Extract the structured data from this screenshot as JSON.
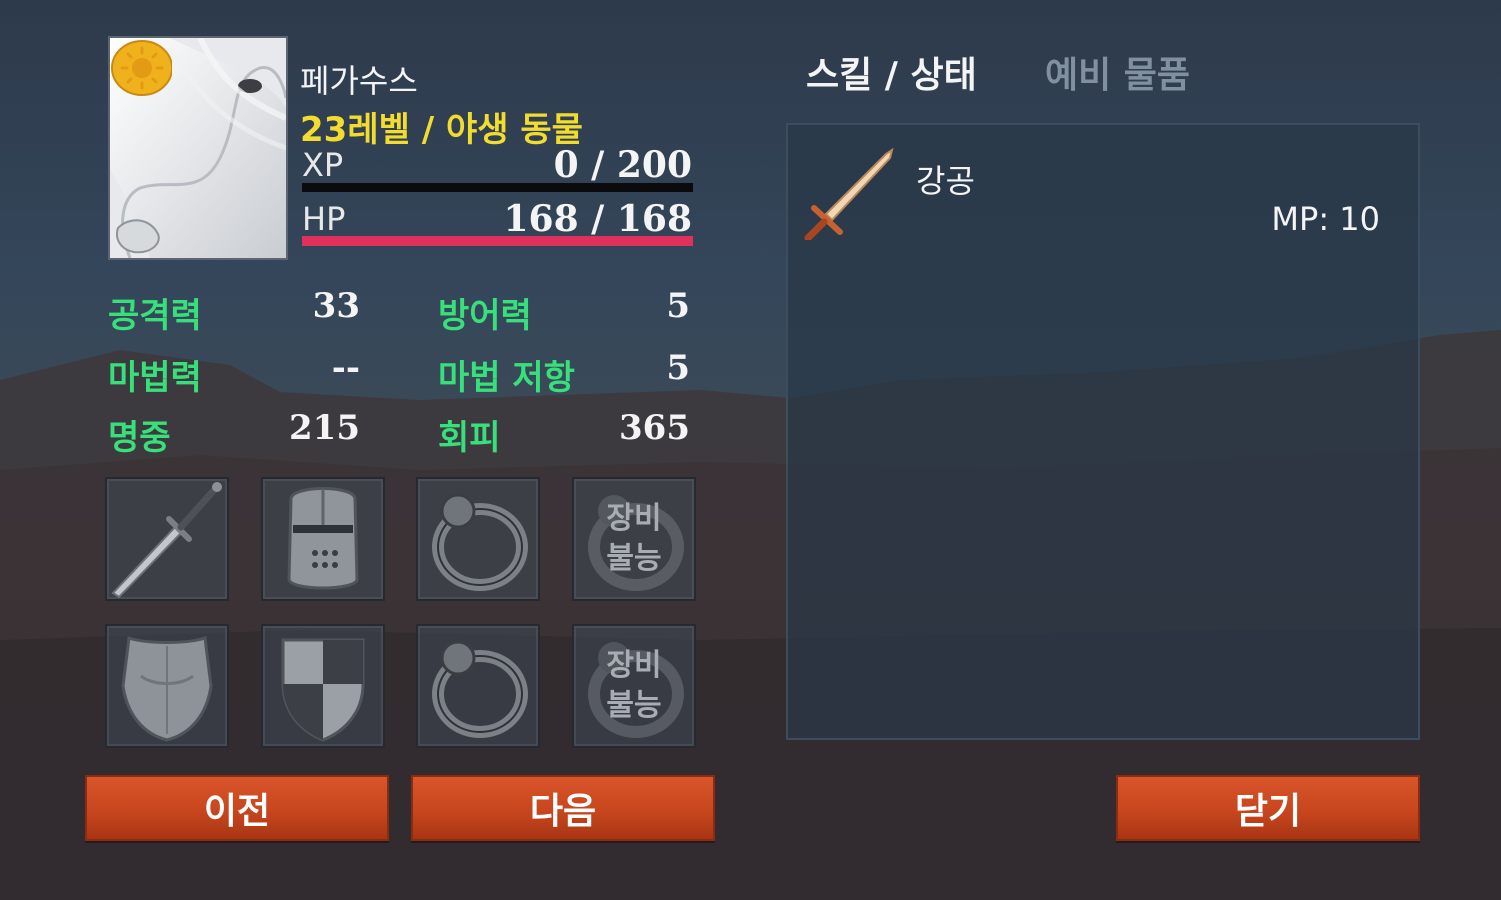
{
  "character": {
    "name": "페가수스",
    "level_line": "23레벨 / 야생 동물",
    "xp_label": "XP",
    "xp_value": "0 / 200",
    "xp_fraction": 0,
    "hp_label": "HP",
    "hp_value": "168 / 168",
    "hp_fraction": 1,
    "portrait_icon": "white-horse-portrait",
    "badge_icon": "sun-icon",
    "colors": {
      "level": "#f2dc2e",
      "stat_label": "#37e07a",
      "hp_bar": "#e0305e",
      "xp_bar": "#0b0b0d"
    }
  },
  "stats": [
    {
      "label": "공격력",
      "value": "33"
    },
    {
      "label": "방어력",
      "value": "5"
    },
    {
      "label": "마법력",
      "value": "--"
    },
    {
      "label": "마법 저항",
      "value": "5"
    },
    {
      "label": "명중",
      "value": "215"
    },
    {
      "label": "회피",
      "value": "365"
    }
  ],
  "equipment": {
    "slots": [
      {
        "icon": "dagger-icon"
      },
      {
        "icon": "helmet-icon"
      },
      {
        "icon": "ring-icon"
      },
      {
        "icon": "ring-icon",
        "text_line1": "장비",
        "text_line2": "불능"
      },
      {
        "icon": "chest-armor-icon"
      },
      {
        "icon": "shield-icon"
      },
      {
        "icon": "ring-icon"
      },
      {
        "icon": "ring-icon",
        "text_line1": "장비",
        "text_line2": "불능"
      }
    ]
  },
  "buttons": {
    "prev": "이전",
    "next": "다음",
    "close": "닫기"
  },
  "tabs": {
    "skills": "스킬 / 상태",
    "spare_items": "예비 물품"
  },
  "skills": [
    {
      "name": "강공",
      "mp": "MP: 10",
      "icon": "sword-icon"
    }
  ]
}
